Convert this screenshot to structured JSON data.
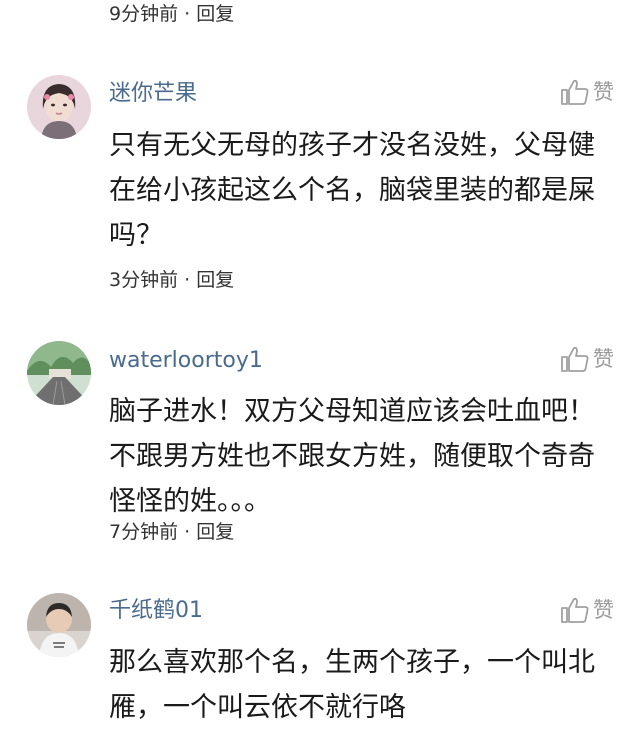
{
  "top_meta": "9分钟前 · 回复",
  "comments": [
    {
      "username": "迷你芒果",
      "like_label": "赞",
      "text": "只有无父无母的孩子才没名没姓，父母健在给小孩起这么个名，脑袋里装的都是屎吗？",
      "meta": "3分钟前 · 回复"
    },
    {
      "username": "waterloortoy1",
      "like_label": "赞",
      "text": "脑子进水！双方父母知道应该会吐血吧！不跟男方姓也不跟女方姓，随便取个奇奇怪怪的姓。。。",
      "meta": "7分钟前 · 回复"
    },
    {
      "username": "千纸鹤01",
      "like_label": "赞",
      "text": "那么喜欢那个名，生两个孩子，一个叫北雁，一个叫云依不就行咯",
      "meta": ""
    }
  ],
  "icons": {
    "like": "thumbs-up-outline-icon"
  },
  "colors": {
    "username": "#4a6a8e",
    "meta": "#333333",
    "like": "#9a9a9a",
    "text": "#1a1a1a"
  }
}
